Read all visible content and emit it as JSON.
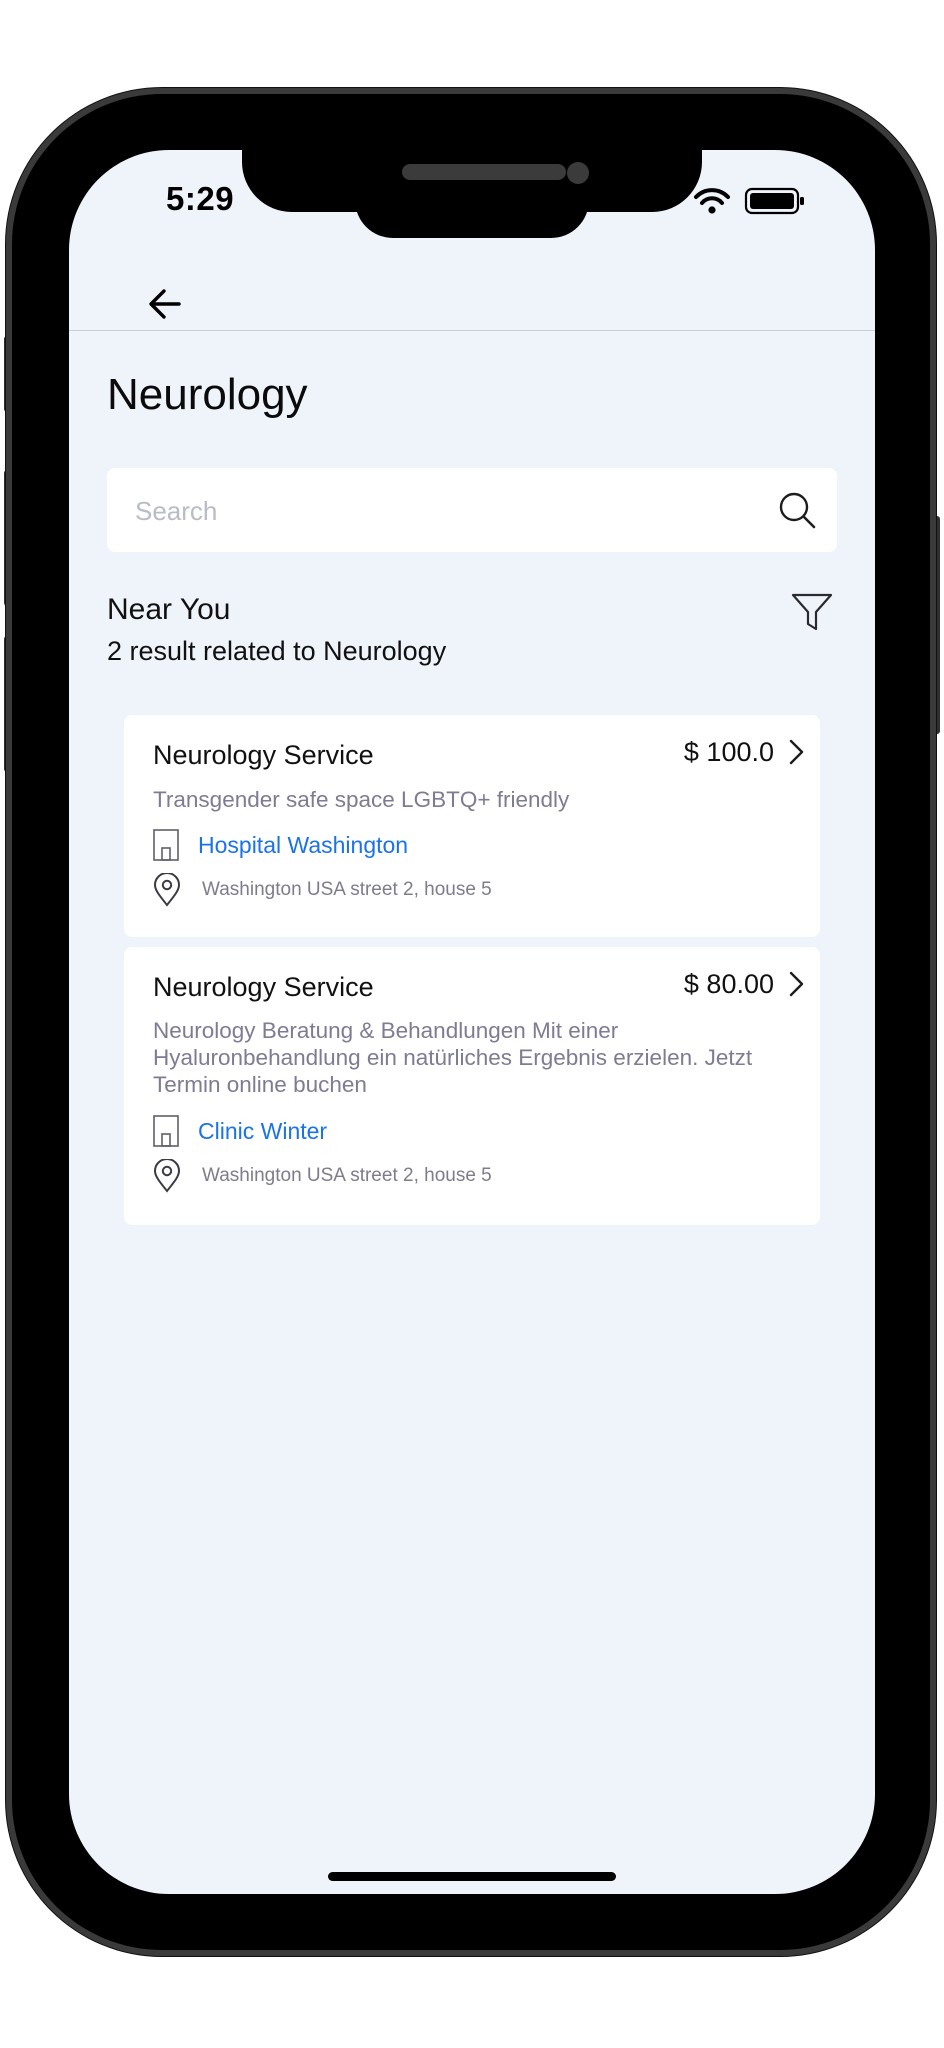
{
  "status_bar": {
    "time": "5:29"
  },
  "header": {
    "back_icon": "arrow-left-icon"
  },
  "page": {
    "title": "Neurology"
  },
  "search": {
    "placeholder": "Search",
    "value": "",
    "icon": "search-icon"
  },
  "section": {
    "title": "Near You",
    "subtitle": "2 result related to Neurology",
    "filter_icon": "filter-icon"
  },
  "results": [
    {
      "title": "Neurology Service",
      "price": "$ 100.0",
      "description": "Transgender safe space LGBTQ+ friendly",
      "provider": "Hospital Washington",
      "address": "Washington USA street 2, house 5"
    },
    {
      "title": "Neurology Service",
      "price": "$ 80.00",
      "description": "Neurology Beratung & Behandlungen Mit einer Hyaluronbehandlung ein natürliches Ergebnis erzielen. Jetzt Termin online buchen",
      "provider": "Clinic Winter",
      "address": "Washington USA street 2, house 5"
    }
  ],
  "colors": {
    "screen_background": "#eff4fb",
    "card_background": "#ffffff",
    "link": "#1a73e8",
    "muted_text": "#7d7c93"
  }
}
